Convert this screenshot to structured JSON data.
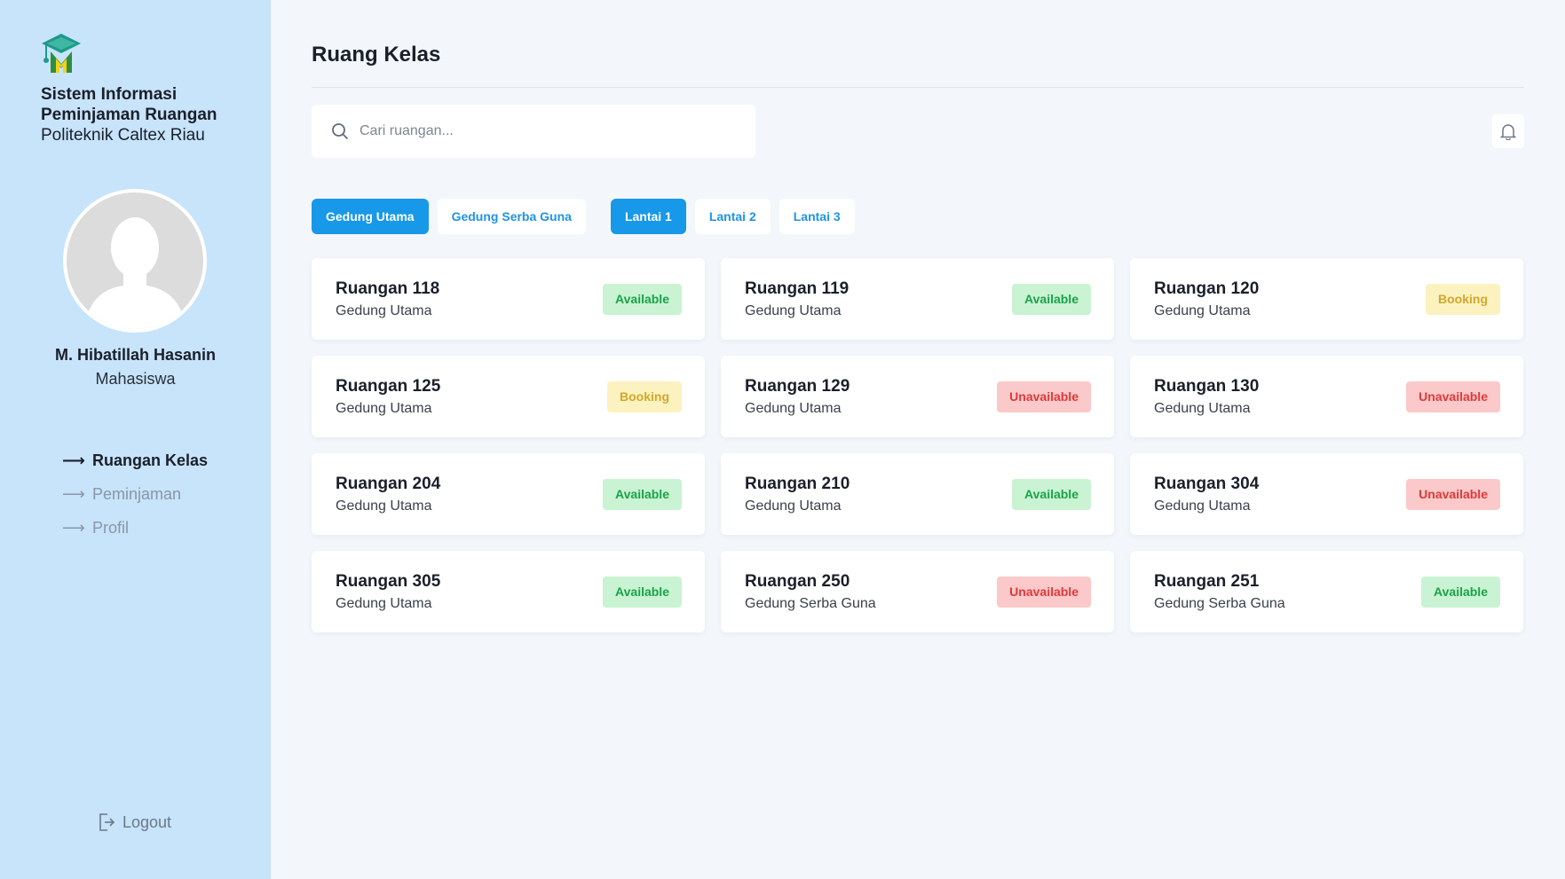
{
  "sidebar": {
    "brand": {
      "line1": "Sistem Informasi",
      "line2": "Peminjaman Ruangan",
      "line3": "Politeknik Caltex Riau"
    },
    "logo_icon": "graduation-cap-m-logo",
    "user": {
      "name": "M. Hibatillah Hasanin",
      "role": "Mahasiswa"
    },
    "nav": [
      {
        "label": "Ruangan Kelas",
        "active": true
      },
      {
        "label": "Peminjaman",
        "active": false
      },
      {
        "label": "Profil",
        "active": false
      }
    ],
    "logout_label": "Logout"
  },
  "main": {
    "title": "Ruang Kelas",
    "search": {
      "placeholder": "Cari ruangan..."
    },
    "buildings": [
      {
        "label": "Gedung Utama",
        "active": true
      },
      {
        "label": "Gedung Serba Guna",
        "active": false
      }
    ],
    "floors": [
      {
        "label": "Lantai 1",
        "active": true
      },
      {
        "label": "Lantai 2",
        "active": false
      },
      {
        "label": "Lantai 3",
        "active": false
      }
    ],
    "rooms": [
      {
        "name": "Ruangan 118",
        "building": "Gedung Utama",
        "status": "Available"
      },
      {
        "name": "Ruangan 119",
        "building": "Gedung Utama",
        "status": "Available"
      },
      {
        "name": "Ruangan 120",
        "building": "Gedung Utama",
        "status": "Booking"
      },
      {
        "name": "Ruangan 125",
        "building": "Gedung Utama",
        "status": "Booking"
      },
      {
        "name": "Ruangan 129",
        "building": "Gedung Utama",
        "status": "Unavailable"
      },
      {
        "name": "Ruangan 130",
        "building": "Gedung Utama",
        "status": "Unavailable"
      },
      {
        "name": "Ruangan 204",
        "building": "Gedung Utama",
        "status": "Available"
      },
      {
        "name": "Ruangan 210",
        "building": "Gedung Utama",
        "status": "Available"
      },
      {
        "name": "Ruangan 304",
        "building": "Gedung Utama",
        "status": "Unavailable"
      },
      {
        "name": "Ruangan 305",
        "building": "Gedung Utama",
        "status": "Available"
      },
      {
        "name": "Ruangan 250",
        "building": "Gedung Serba Guna",
        "status": "Unavailable"
      },
      {
        "name": "Ruangan 251",
        "building": "Gedung Serba Guna",
        "status": "Available"
      }
    ]
  },
  "colors": {
    "sidebar_bg": "#c7e4fb",
    "accent": "#1898e8",
    "available": "#1aa34a",
    "booking": "#d4a72c",
    "unavailable": "#e0393a"
  }
}
